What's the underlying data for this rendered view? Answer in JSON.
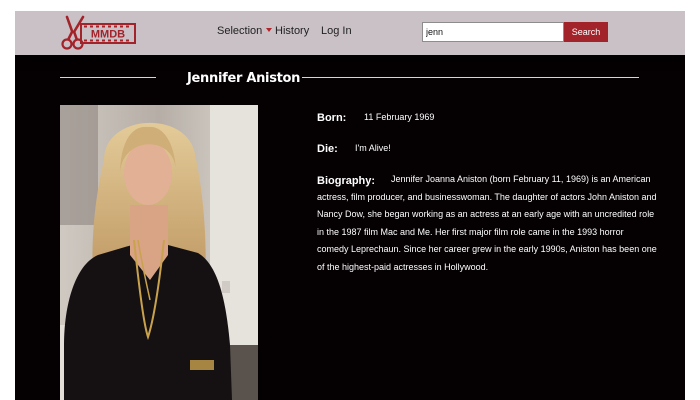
{
  "header": {
    "logo_text": "MMDB",
    "nav": {
      "selection_label": "Selection",
      "history_label": "History",
      "login_label": "Log In"
    },
    "search": {
      "value": "jenn",
      "button_label": "Search"
    }
  },
  "person": {
    "name": "Jennifer Aniston",
    "born_label": "Born:",
    "born_value": "11 February 1969",
    "die_label": "Die:",
    "die_value": "I'm Alive!",
    "bio_label": "Biography:",
    "bio_text": "Jennifer Joanna Aniston (born February 11, 1969) is an American actress, film producer, and businesswoman. The daughter of actors John Aniston and Nancy Dow, she began working as an actress at an early age with an uncredited role in the 1987 film Mac and Me. Her first major film role came in the 1993 horror comedy Leprechaun. Since her career grew in the early 1990s, Aniston has been one of the highest-paid actresses in Hollywood."
  },
  "colors": {
    "navbar_bg": "#c9c1c6",
    "page_bg": "#050103",
    "accent": "#a3232b"
  }
}
